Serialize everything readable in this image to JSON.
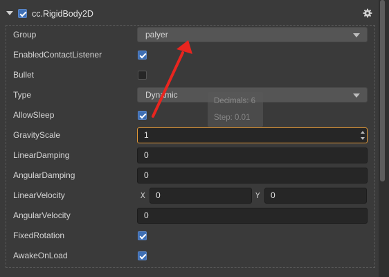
{
  "component": {
    "title": "cc.RigidBody2D",
    "enabled": true
  },
  "properties": {
    "group": {
      "label": "Group",
      "value": "palyer"
    },
    "enabled_contact_listener": {
      "label": "EnabledContactListener",
      "checked": true
    },
    "bullet": {
      "label": "Bullet",
      "checked": false
    },
    "type": {
      "label": "Type",
      "value": "Dynamic"
    },
    "allow_sleep": {
      "label": "AllowSleep",
      "checked": true
    },
    "gravity_scale": {
      "label": "GravityScale",
      "value": "1"
    },
    "linear_damping": {
      "label": "LinearDamping",
      "value": "0"
    },
    "angular_damping": {
      "label": "AngularDamping",
      "value": "0"
    },
    "linear_velocity": {
      "label": "LinearVelocity",
      "x_label": "X",
      "x": "0",
      "y_label": "Y",
      "y": "0"
    },
    "angular_velocity": {
      "label": "AngularVelocity",
      "value": "0"
    },
    "fixed_rotation": {
      "label": "FixedRotation",
      "checked": true
    },
    "awake_on_load": {
      "label": "AwakeOnLoad",
      "checked": true
    }
  },
  "tooltip": {
    "decimals": "Decimals: 6",
    "step": "Step: 0.01"
  },
  "colors": {
    "accent": "#3e6fb5",
    "focus": "#e59a36",
    "annotation": "#e8251f"
  },
  "icons": {
    "settings": "gear-icon",
    "collapse": "triangle-down-icon"
  }
}
